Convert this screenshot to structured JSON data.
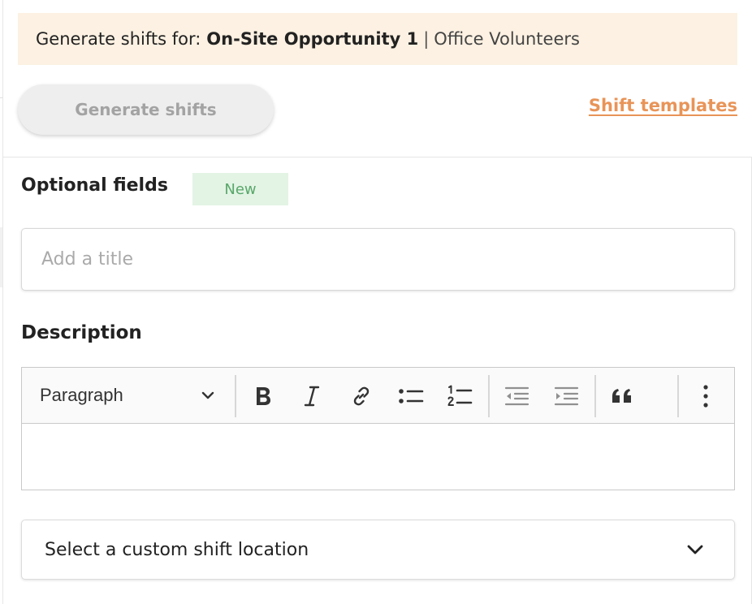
{
  "banner": {
    "prefix": "Generate shifts for:",
    "opportunity": "On-Site Opportunity 1",
    "separator": "|",
    "team": "Office Volunteers",
    "background_color": "#fcf1e2"
  },
  "actions": {
    "generate_label": "Generate shifts",
    "generate_state": "disabled",
    "templates_link": "Shift templates",
    "accent_color": "#e89458"
  },
  "optional_fields": {
    "heading": "Optional fields",
    "badge": "New",
    "title_placeholder": "Add a title"
  },
  "description": {
    "heading": "Description",
    "format_selected": "Paragraph",
    "toolbar_icons": [
      "bold-icon",
      "italic-icon",
      "link-icon",
      "bulleted-list-icon",
      "numbered-list-icon",
      "outdent-icon",
      "indent-icon",
      "blockquote-icon",
      "more-options-icon"
    ],
    "content": ""
  },
  "location": {
    "placeholder": "Select a custom shift location"
  }
}
